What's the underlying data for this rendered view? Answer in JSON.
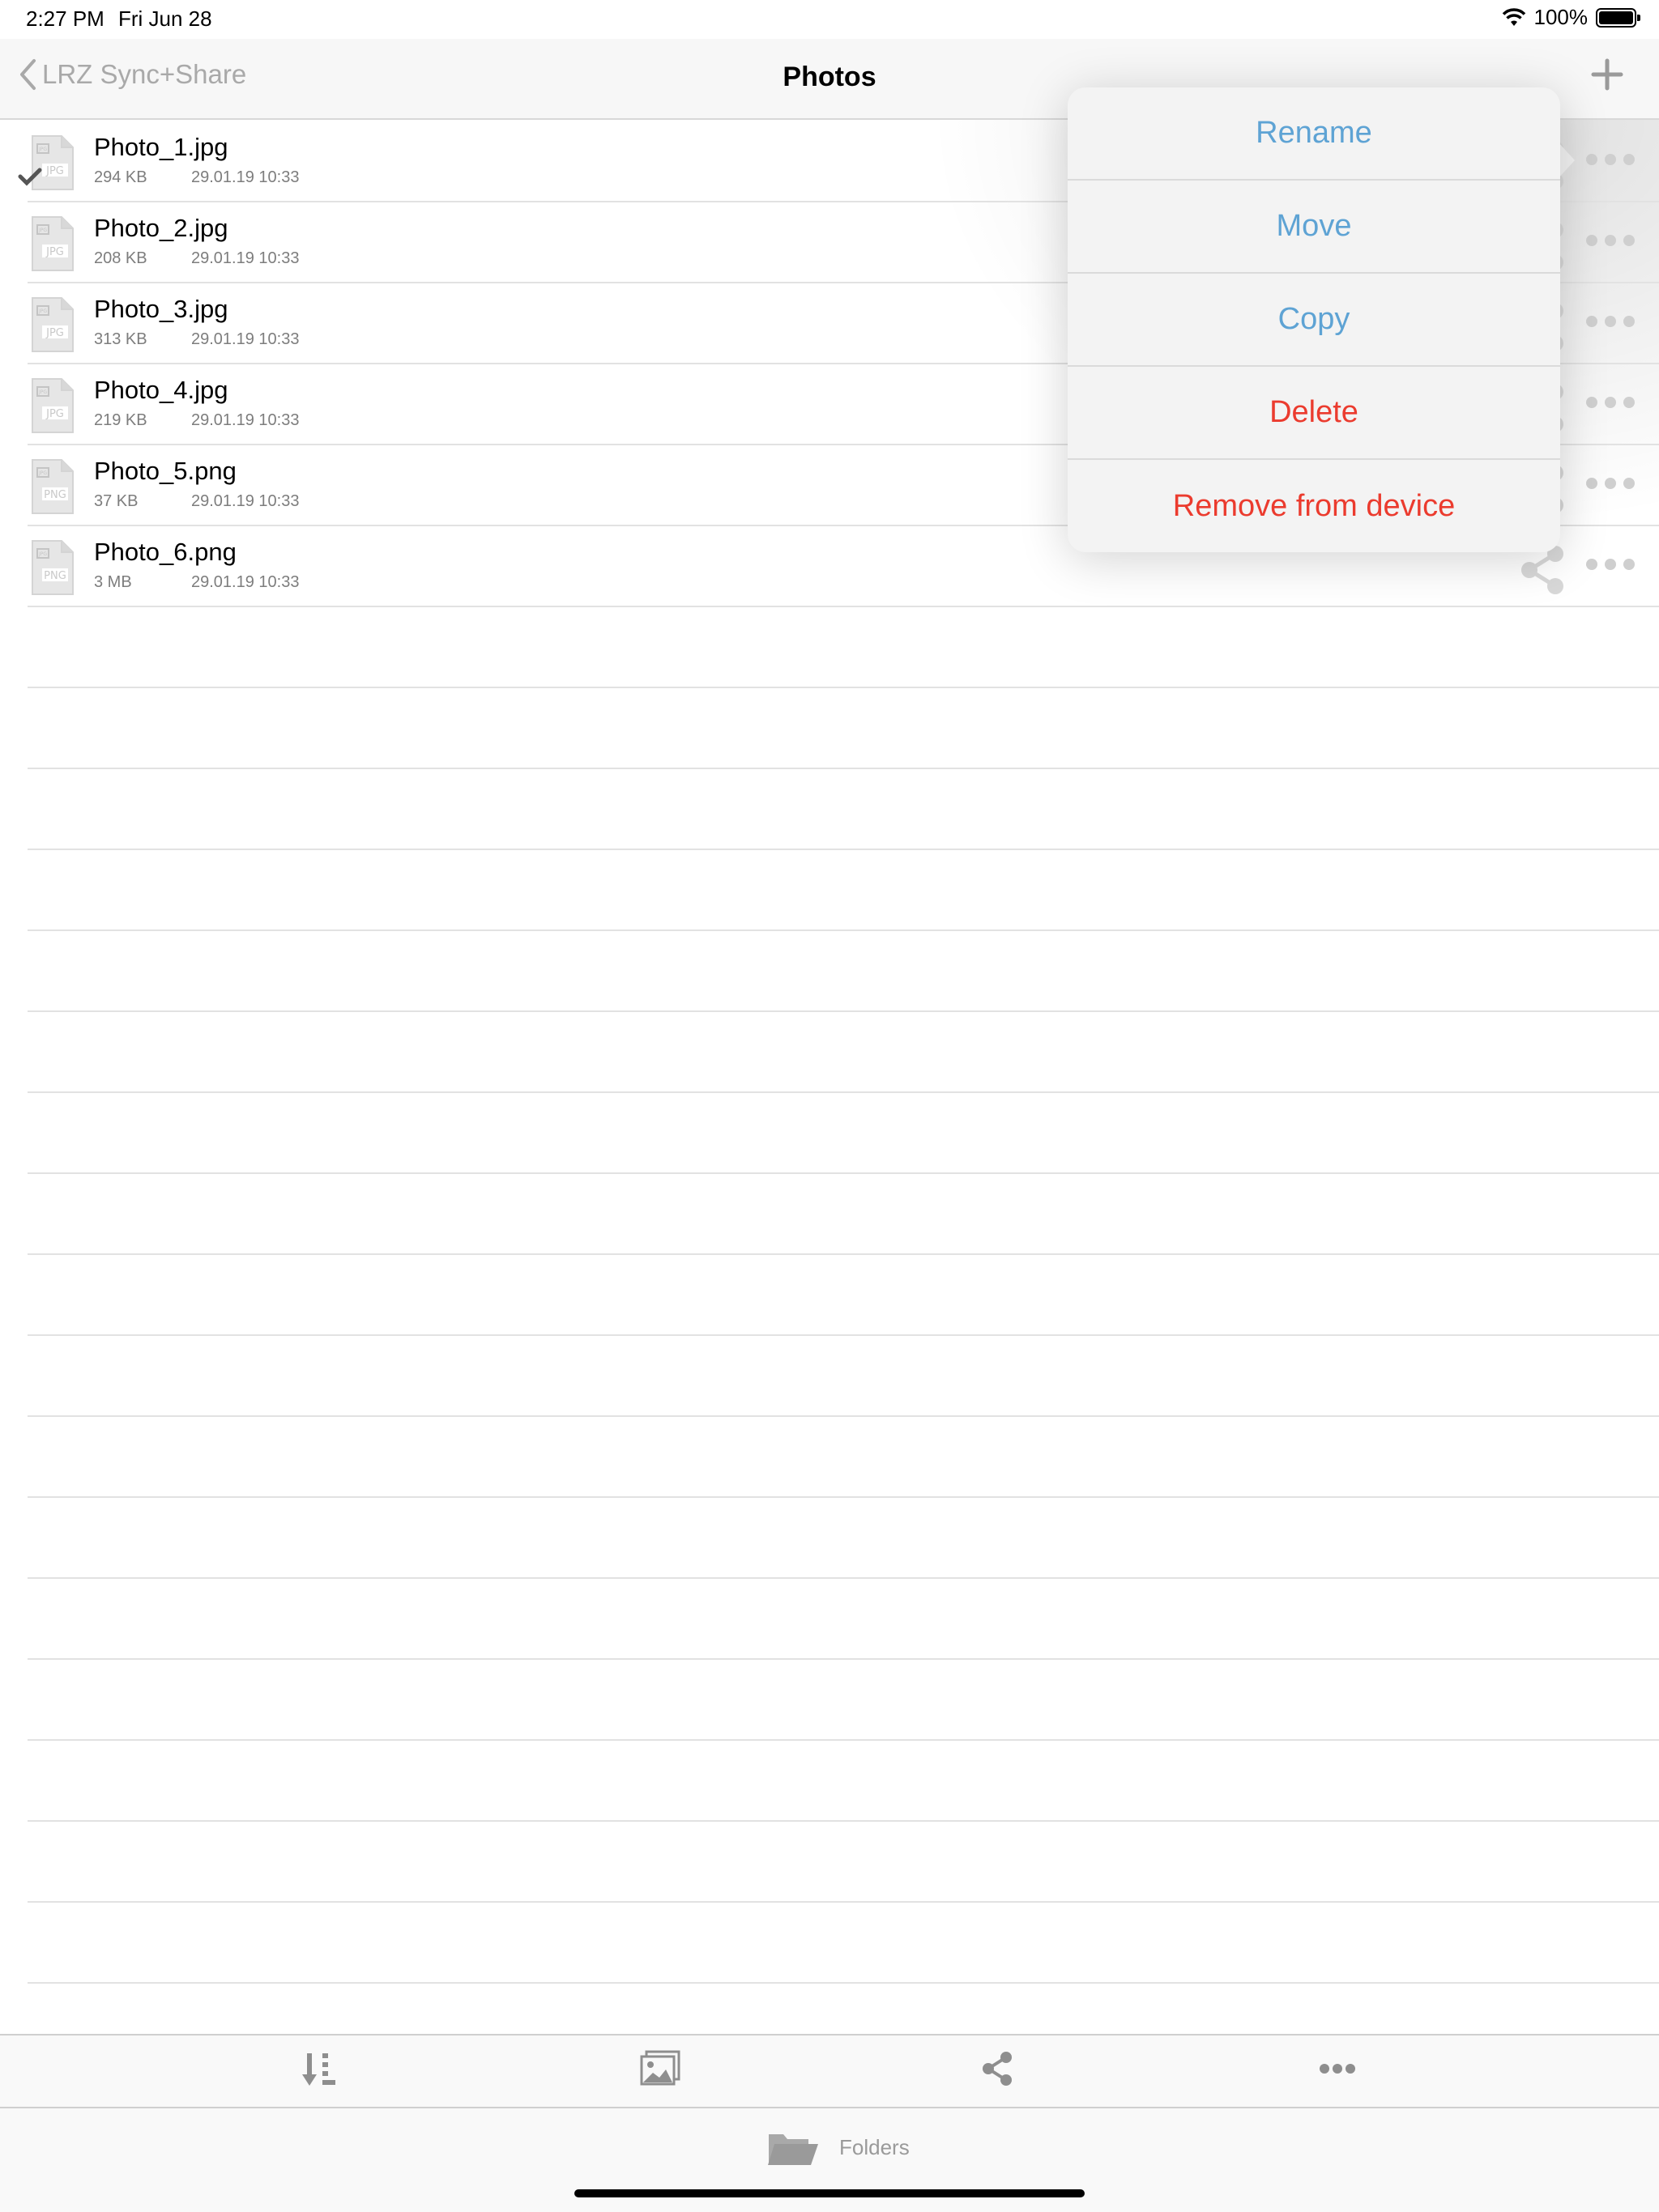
{
  "status_bar": {
    "time": "2:27 PM",
    "date": "Fri Jun 28",
    "battery_percent": "100%",
    "battery_level": 1.0
  },
  "nav": {
    "back_label": "LRZ Sync+Share",
    "title": "Photos",
    "add_icon": "plus-icon"
  },
  "files": [
    {
      "name": "Photo_1.jpg",
      "size": "294 KB",
      "date": "29.01.19 10:33",
      "ext": "JPG",
      "checked": true
    },
    {
      "name": "Photo_2.jpg",
      "size": "208 KB",
      "date": "29.01.19 10:33",
      "ext": "JPG",
      "checked": false
    },
    {
      "name": "Photo_3.jpg",
      "size": "313 KB",
      "date": "29.01.19 10:33",
      "ext": "JPG",
      "checked": false
    },
    {
      "name": "Photo_4.jpg",
      "size": "219 KB",
      "date": "29.01.19 10:33",
      "ext": "JPG",
      "checked": false
    },
    {
      "name": "Photo_5.png",
      "size": "37 KB",
      "date": "29.01.19 10:33",
      "ext": "PNG",
      "checked": false
    },
    {
      "name": "Photo_6.png",
      "size": "3 MB",
      "date": "29.01.19 10:33",
      "ext": "PNG",
      "checked": false
    }
  ],
  "popover": {
    "rename": "Rename",
    "move": "Move",
    "copy": "Copy",
    "delete": "Delete",
    "remove": "Remove from device"
  },
  "toolbar": {
    "icons": [
      "sort-icon",
      "image-icon",
      "share-icon",
      "more-icon"
    ]
  },
  "tab_bar": {
    "folders_label": "Folders"
  },
  "colors": {
    "action_blue": "#5ea3d4",
    "destructive_red": "#eb3b2e",
    "icon_gray": "#a9a9a9"
  }
}
